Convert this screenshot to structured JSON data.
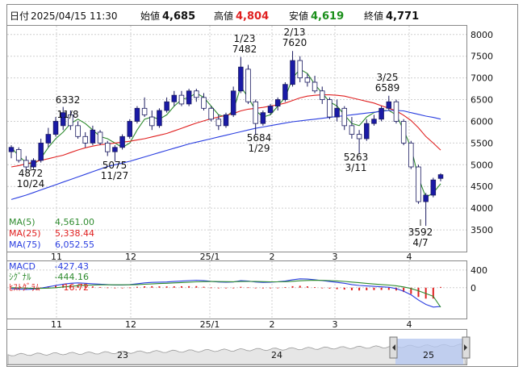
{
  "header": {
    "date_label": "日付",
    "datetime": "2025/04/15 11:30",
    "open_label": "始値",
    "open": "4,685",
    "high_label": "高値",
    "high": "4,804",
    "low_label": "安値",
    "low": "4,619",
    "close_label": "終値",
    "close": "4,771"
  },
  "colors": {
    "up_candle": "#1a1aa6",
    "down_candle": "#ffffff",
    "ma5": "#2e8b2e",
    "ma25": "#e02020",
    "ma75": "#2a3ee0",
    "high_value": "#e02020",
    "low_value": "#1a8f1a",
    "macd": "#2a3ee0",
    "signal": "#2e8b2e",
    "histogram": "#e02020"
  },
  "chart_data": [
    {
      "type": "candlestick",
      "ylim": [
        3000,
        8200
      ],
      "yticks": [
        "8000",
        "7500",
        "7000",
        "6500",
        "6000",
        "5500",
        "5000",
        "4500",
        "4000",
        "3500"
      ],
      "x_ticks": [
        "11",
        "12",
        "25/1",
        "2",
        "3",
        "4"
      ],
      "grid": true,
      "annotations": [
        {
          "date": "10/24",
          "value": "4872",
          "position": "below"
        },
        {
          "date": "11/8",
          "value": "6332",
          "position": "above"
        },
        {
          "date": "11/27",
          "value": "5075",
          "position": "below"
        },
        {
          "date": "1/23",
          "value": "7482",
          "position": "above"
        },
        {
          "date": "1/29",
          "value": "5684",
          "position": "below"
        },
        {
          "date": "2/13",
          "value": "7620",
          "position": "above"
        },
        {
          "date": "3/11",
          "value": "5263",
          "position": "below"
        },
        {
          "date": "3/25",
          "value": "6589",
          "position": "above"
        },
        {
          "date": "4/7",
          "value": "3592",
          "position": "below"
        }
      ],
      "legend": [
        {
          "name": "MA(5)",
          "value": "4,561.00"
        },
        {
          "name": "MA(25)",
          "value": "5,338.44"
        },
        {
          "name": "MA(75)",
          "value": "6,052.55"
        }
      ],
      "series": [
        {
          "name": "MA(5)",
          "values": [
            5400,
            5200,
            5050,
            5000,
            5150,
            5400,
            5600,
            5750,
            5950,
            6050,
            5950,
            5800,
            5650,
            5600,
            5500,
            5400,
            5500,
            5800,
            6050,
            6100,
            6050,
            6150,
            6350,
            6500,
            6550,
            6650,
            6550,
            6350,
            6150,
            6100,
            6250,
            6800,
            6550,
            6250,
            6100,
            6150,
            6350,
            6550,
            7000,
            7200,
            7100,
            6850,
            6650,
            6450,
            6350,
            6150,
            5950,
            5900,
            6100,
            6200,
            6250,
            6250,
            6150,
            5800,
            5400,
            4700,
            4250,
            4350,
            4561
          ]
        },
        {
          "name": "MA(25)",
          "values": [
            4950,
            4980,
            5020,
            5060,
            5100,
            5140,
            5180,
            5220,
            5280,
            5340,
            5390,
            5430,
            5460,
            5480,
            5500,
            5520,
            5540,
            5570,
            5600,
            5640,
            5680,
            5720,
            5780,
            5840,
            5900,
            5960,
            6010,
            6060,
            6100,
            6140,
            6180,
            6240,
            6280,
            6300,
            6320,
            6350,
            6380,
            6420,
            6480,
            6540,
            6580,
            6600,
            6610,
            6610,
            6600,
            6580,
            6540,
            6500,
            6460,
            6420,
            6360,
            6300,
            6240,
            6140,
            6020,
            5850,
            5650,
            5500,
            5338
          ]
        },
        {
          "name": "MA(75)",
          "values": [
            4200,
            4250,
            4300,
            4360,
            4420,
            4480,
            4540,
            4600,
            4660,
            4720,
            4780,
            4840,
            4900,
            4960,
            5000,
            5040,
            5080,
            5130,
            5180,
            5230,
            5280,
            5330,
            5380,
            5430,
            5480,
            5520,
            5560,
            5600,
            5640,
            5680,
            5720,
            5760,
            5800,
            5840,
            5870,
            5900,
            5930,
            5960,
            5990,
            6010,
            6030,
            6050,
            6070,
            6090,
            6110,
            6130,
            6150,
            6170,
            6190,
            6210,
            6230,
            6250,
            6250,
            6240,
            6200,
            6160,
            6120,
            6090,
            6052
          ]
        }
      ],
      "candles": [
        {
          "o": 5300,
          "h": 5450,
          "l": 5150,
          "c": 5400
        },
        {
          "o": 5350,
          "h": 5400,
          "l": 5050,
          "c": 5100
        },
        {
          "o": 5100,
          "h": 5200,
          "l": 4872,
          "c": 4950
        },
        {
          "o": 4950,
          "h": 5150,
          "l": 4900,
          "c": 5100
        },
        {
          "o": 5100,
          "h": 5600,
          "l": 5050,
          "c": 5500
        },
        {
          "o": 5500,
          "h": 5850,
          "l": 5400,
          "c": 5700
        },
        {
          "o": 5700,
          "h": 6100,
          "l": 5650,
          "c": 6000
        },
        {
          "o": 5900,
          "h": 6332,
          "l": 5800,
          "c": 6200
        },
        {
          "o": 6150,
          "h": 6250,
          "l": 5800,
          "c": 5900
        },
        {
          "o": 5900,
          "h": 6000,
          "l": 5600,
          "c": 5650
        },
        {
          "o": 5650,
          "h": 5750,
          "l": 5400,
          "c": 5500
        },
        {
          "o": 5500,
          "h": 5900,
          "l": 5450,
          "c": 5800
        },
        {
          "o": 5750,
          "h": 5800,
          "l": 5450,
          "c": 5500
        },
        {
          "o": 5500,
          "h": 5550,
          "l": 5200,
          "c": 5300
        },
        {
          "o": 5300,
          "h": 5450,
          "l": 5075,
          "c": 5400
        },
        {
          "o": 5400,
          "h": 5700,
          "l": 5350,
          "c": 5650
        },
        {
          "o": 5650,
          "h": 6050,
          "l": 5600,
          "c": 6000
        },
        {
          "o": 6000,
          "h": 6350,
          "l": 5950,
          "c": 6300
        },
        {
          "o": 6300,
          "h": 6550,
          "l": 6100,
          "c": 6150
        },
        {
          "o": 6100,
          "h": 6250,
          "l": 5800,
          "c": 5900
        },
        {
          "o": 5900,
          "h": 6300,
          "l": 5850,
          "c": 6250
        },
        {
          "o": 6250,
          "h": 6550,
          "l": 6200,
          "c": 6450
        },
        {
          "o": 6450,
          "h": 6700,
          "l": 6350,
          "c": 6600
        },
        {
          "o": 6600,
          "h": 6700,
          "l": 6350,
          "c": 6400
        },
        {
          "o": 6400,
          "h": 6750,
          "l": 6350,
          "c": 6700
        },
        {
          "o": 6700,
          "h": 6750,
          "l": 6450,
          "c": 6550
        },
        {
          "o": 6550,
          "h": 6650,
          "l": 6250,
          "c": 6300
        },
        {
          "o": 6300,
          "h": 6350,
          "l": 6000,
          "c": 6050
        },
        {
          "o": 6050,
          "h": 6150,
          "l": 5800,
          "c": 5900
        },
        {
          "o": 5900,
          "h": 6200,
          "l": 5850,
          "c": 6150
        },
        {
          "o": 6150,
          "h": 6800,
          "l": 6100,
          "c": 6700
        },
        {
          "o": 6700,
          "h": 7482,
          "l": 6650,
          "c": 7250
        },
        {
          "o": 7200,
          "h": 7300,
          "l": 6400,
          "c": 6450
        },
        {
          "o": 6450,
          "h": 6500,
          "l": 5684,
          "c": 5950
        },
        {
          "o": 5950,
          "h": 6250,
          "l": 5900,
          "c": 6200
        },
        {
          "o": 6200,
          "h": 6400,
          "l": 6150,
          "c": 6350
        },
        {
          "o": 6350,
          "h": 6550,
          "l": 6250,
          "c": 6500
        },
        {
          "o": 6500,
          "h": 6900,
          "l": 6450,
          "c": 6850
        },
        {
          "o": 6850,
          "h": 7620,
          "l": 6800,
          "c": 7400
        },
        {
          "o": 7400,
          "h": 7500,
          "l": 6900,
          "c": 7000
        },
        {
          "o": 7000,
          "h": 7100,
          "l": 6800,
          "c": 6900
        },
        {
          "o": 6900,
          "h": 7050,
          "l": 6650,
          "c": 6700
        },
        {
          "o": 6700,
          "h": 6800,
          "l": 6400,
          "c": 6500
        },
        {
          "o": 6500,
          "h": 6550,
          "l": 6050,
          "c": 6100
        },
        {
          "o": 6100,
          "h": 6500,
          "l": 6000,
          "c": 6300
        },
        {
          "o": 6300,
          "h": 6350,
          "l": 5800,
          "c": 5900
        },
        {
          "o": 5900,
          "h": 6100,
          "l": 5600,
          "c": 5700
        },
        {
          "o": 5700,
          "h": 5800,
          "l": 5263,
          "c": 5600
        },
        {
          "o": 5600,
          "h": 6050,
          "l": 5550,
          "c": 5950
        },
        {
          "o": 5950,
          "h": 6150,
          "l": 5900,
          "c": 6050
        },
        {
          "o": 6050,
          "h": 6350,
          "l": 6000,
          "c": 6300
        },
        {
          "o": 6300,
          "h": 6589,
          "l": 6250,
          "c": 6450
        },
        {
          "o": 6450,
          "h": 6500,
          "l": 5950,
          "c": 6000
        },
        {
          "o": 6000,
          "h": 6050,
          "l": 5450,
          "c": 5500
        },
        {
          "o": 5500,
          "h": 5550,
          "l": 4900,
          "c": 4950
        },
        {
          "o": 4950,
          "h": 5000,
          "l": 4100,
          "c": 4150
        },
        {
          "o": 4150,
          "h": 4350,
          "l": 3592,
          "c": 4300
        },
        {
          "o": 4300,
          "h": 4700,
          "l": 4250,
          "c": 4650
        },
        {
          "o": 4685,
          "h": 4804,
          "l": 4619,
          "c": 4771
        }
      ]
    },
    {
      "type": "line",
      "ylim": [
        -700,
        600
      ],
      "yticks": [
        "400",
        "0"
      ],
      "legend": [
        {
          "name": "MACD",
          "value": "-427.43"
        },
        {
          "name": "ｼｸﾞﾅﾙ",
          "value": "-444.16"
        },
        {
          "name": "ﾋｽﾄｸﾞﾗﾑ",
          "value": "16.72"
        }
      ],
      "series": [
        {
          "name": "MACD",
          "values": [
            -20,
            -30,
            -40,
            -30,
            -10,
            20,
            50,
            80,
            100,
            110,
            100,
            90,
            80,
            70,
            60,
            60,
            70,
            90,
            110,
            120,
            125,
            130,
            140,
            150,
            160,
            170,
            160,
            145,
            130,
            125,
            130,
            160,
            150,
            130,
            120,
            125,
            135,
            150,
            180,
            200,
            195,
            180,
            160,
            140,
            120,
            100,
            70,
            50,
            40,
            30,
            20,
            10,
            -20,
            -80,
            -160,
            -280,
            -380,
            -440,
            -427
          ]
        },
        {
          "name": "ｼｸﾞﾅﾙ",
          "values": [
            0,
            -5,
            -10,
            -15,
            -15,
            -10,
            0,
            15,
            30,
            45,
            55,
            60,
            65,
            65,
            65,
            65,
            65,
            70,
            78,
            86,
            94,
            101,
            109,
            117,
            125,
            134,
            139,
            140,
            139,
            136,
            135,
            140,
            142,
            140,
            136,
            134,
            134,
            137,
            146,
            157,
            164,
            167,
            166,
            161,
            153,
            142,
            128,
            113,
            98,
            84,
            71,
            59,
            43,
            18,
            -18,
            -70,
            -132,
            -194,
            -444
          ]
        },
        {
          "name": "ﾋｽﾄｸﾞﾗﾑ",
          "values": [
            -20,
            -25,
            -30,
            -15,
            5,
            30,
            50,
            65,
            70,
            65,
            45,
            30,
            15,
            5,
            -5,
            -5,
            5,
            20,
            32,
            34,
            31,
            29,
            31,
            33,
            35,
            36,
            21,
            5,
            -9,
            -11,
            -5,
            20,
            8,
            -10,
            -16,
            -9,
            1,
            13,
            34,
            43,
            31,
            13,
            -6,
            -21,
            -33,
            -42,
            -58,
            -63,
            -58,
            -54,
            -51,
            -49,
            -63,
            -98,
            -142,
            -210,
            -248,
            -246,
            17
          ]
        }
      ],
      "x_ticks": [
        "11",
        "12",
        "25/1",
        "2",
        "3",
        "4"
      ]
    },
    {
      "type": "area",
      "x_ticks": [
        "23",
        "24",
        "25"
      ]
    }
  ]
}
